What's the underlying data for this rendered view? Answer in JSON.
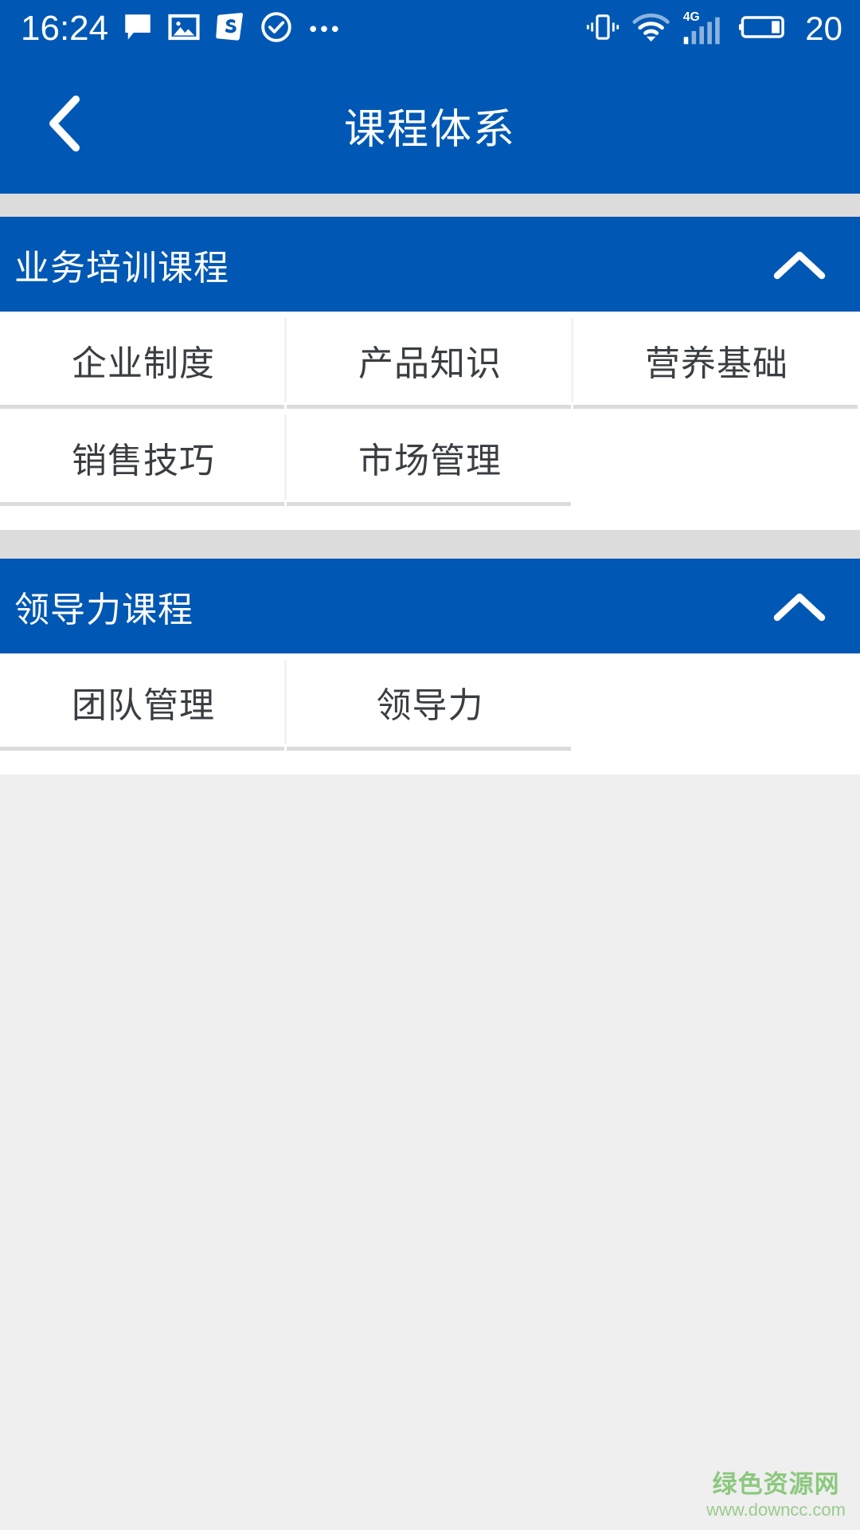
{
  "status_bar": {
    "time": "16:24",
    "battery_percent": "20",
    "network_label": "4G",
    "left_icons": [
      "chat-bubble-icon",
      "photo-gallery-icon",
      "s-app-icon",
      "check-circle-icon",
      "more-dots-icon"
    ],
    "right_icons": [
      "vibrate-icon",
      "wifi-icon",
      "signal-bars-icon",
      "battery-icon"
    ]
  },
  "titlebar": {
    "title": "课程体系",
    "back_icon": "back-chevron-icon"
  },
  "sections": [
    {
      "title": "业务培训课程",
      "expanded": true,
      "chevron_icon": "chevron-up-icon",
      "items": [
        "企业制度",
        "产品知识",
        "营养基础",
        "销售技巧",
        "市场管理"
      ]
    },
    {
      "title": "领导力课程",
      "expanded": true,
      "chevron_icon": "chevron-up-icon",
      "items": [
        "团队管理",
        "领导力"
      ]
    }
  ],
  "watermark": {
    "name": "绿色资源网",
    "url": "www.downcc.com"
  },
  "colors": {
    "brand_blue": "#0058B4",
    "gap_gray": "#DCDCDC",
    "page_bg": "#EFEFEF",
    "divider": "#DBDBDB",
    "text_dark": "#3A3E42",
    "watermark_green": "#8CC87E"
  }
}
